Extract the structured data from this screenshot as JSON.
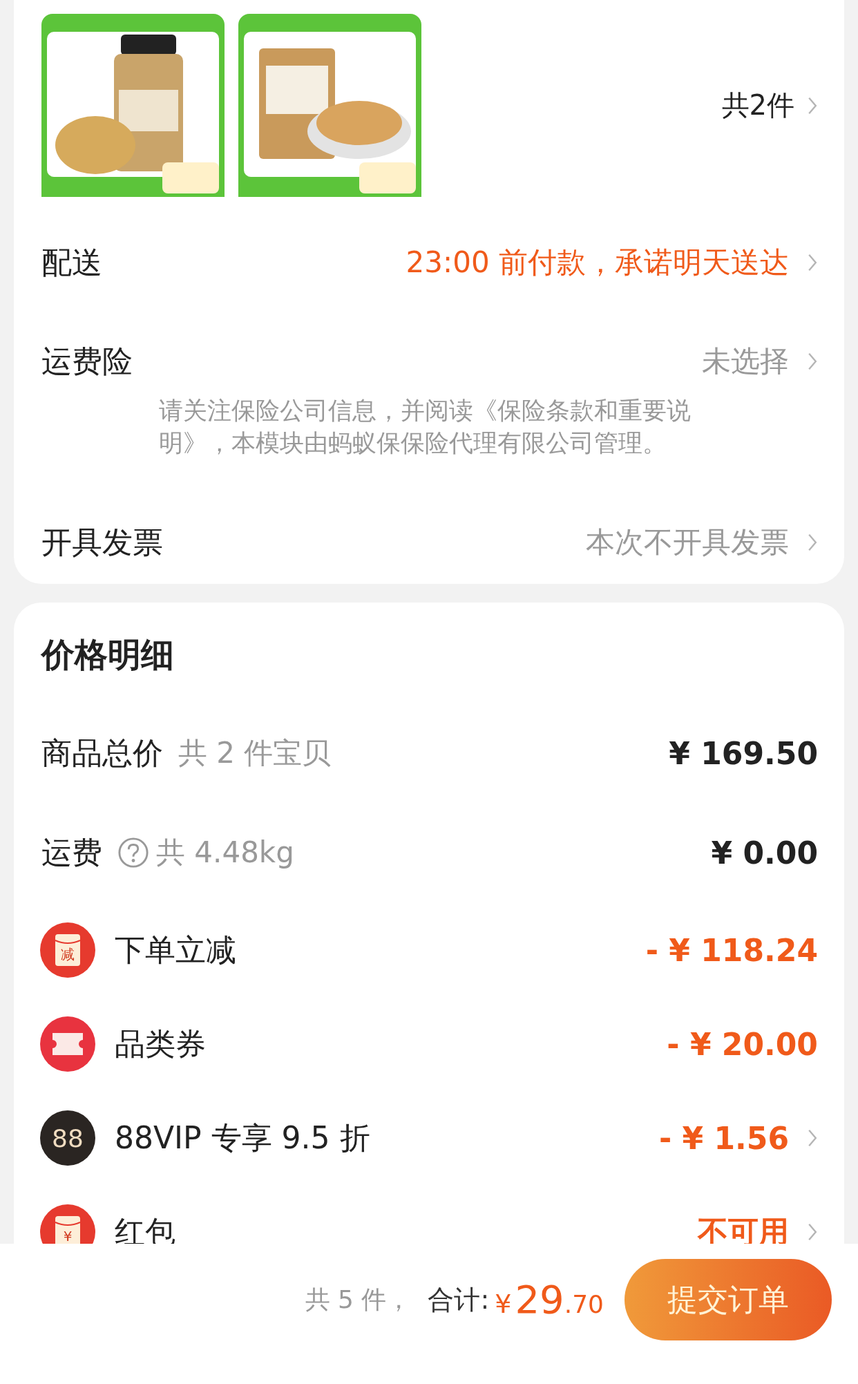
{
  "order_card": {
    "count": "共2件",
    "rows": [
      {
        "kind": "delivery",
        "label": "配送",
        "value": "23:00 前付款，承诺明天送达",
        "highlight": true,
        "chevron": true
      },
      {
        "kind": "insurance",
        "label": "运费险",
        "value": "未选择",
        "highlight": false,
        "chevron": true,
        "notice": "请关注保险公司信息，并阅读《保险条款和重要说明》，本模块由蚂蚁保保险代理有限公司管理。"
      },
      {
        "kind": "invoice",
        "label": "开具发票",
        "value": "本次不开具发票",
        "highlight": false,
        "chevron": true
      }
    ]
  },
  "price_detail": {
    "title": "价格明细",
    "rows": [
      {
        "kind": "plain",
        "label": "商品总价",
        "note": "共 2 件宝贝",
        "help": false,
        "value": "¥ 169.50",
        "highlight": false,
        "chevron": false
      },
      {
        "kind": "plain",
        "label": "运费",
        "note": "共 4.48kg",
        "help": true,
        "value": "¥ 0.00",
        "highlight": false,
        "chevron": false
      },
      {
        "kind": "reduce",
        "badge": "减",
        "label": "下单立减",
        "value": "- ¥ 118.24",
        "highlight": true,
        "chevron": false
      },
      {
        "kind": "coupon",
        "label": "品类券",
        "value": "- ¥ 20.00",
        "highlight": true,
        "chevron": false
      },
      {
        "kind": "vip",
        "badge": "88",
        "label": "88VIP 专享 9.5 折",
        "value": "- ¥ 1.56",
        "highlight": true,
        "chevron": true
      },
      {
        "kind": "packet",
        "badge": "¥",
        "label": "红包",
        "value": "不可用",
        "highlight": true,
        "chevron": true
      }
    ]
  },
  "bottom_bar": {
    "count": "共 5 件，",
    "total_label": "合计:",
    "currency": "¥",
    "amount": "29",
    "decimals": ".70",
    "submit": "提交订单"
  }
}
